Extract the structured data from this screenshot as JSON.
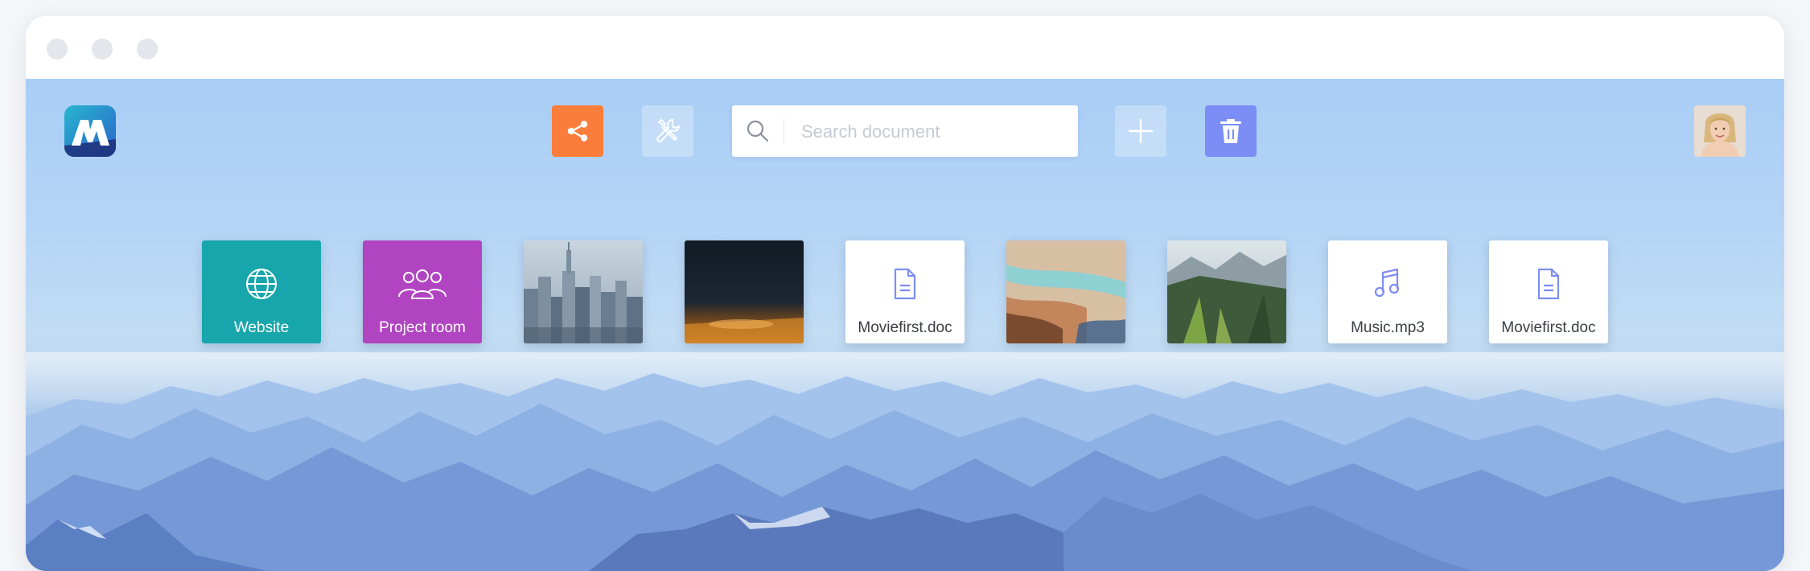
{
  "toolbar": {
    "search_placeholder": "Search document",
    "search_value": ""
  },
  "icons": {
    "logo": "app-logo-m",
    "share": "share-icon",
    "tools": "tools-icon",
    "search": "search-icon",
    "add": "plus-icon",
    "trash": "trash-icon",
    "avatar": "user-avatar"
  },
  "tiles": [
    {
      "label": "Website",
      "type": "link",
      "icon": "globe-icon"
    },
    {
      "label": "Project room",
      "type": "folder",
      "icon": "users-icon"
    },
    {
      "label": "",
      "type": "image",
      "subject": "city skyline"
    },
    {
      "label": "",
      "type": "image",
      "subject": "night sky over horizon"
    },
    {
      "label": "Moviefirst.doc",
      "type": "document",
      "icon": "document-icon"
    },
    {
      "label": "",
      "type": "image",
      "subject": "aerial river"
    },
    {
      "label": "",
      "type": "image",
      "subject": "forest valley"
    },
    {
      "label": "Music.mp3",
      "type": "audio",
      "icon": "music-icon"
    },
    {
      "label": "Moviefirst.doc",
      "type": "document",
      "icon": "document-icon"
    }
  ],
  "colors": {
    "share_button": "#fb7d3c",
    "trash_button": "#7c8df6",
    "website_tile": "#17a6ab",
    "project_room_tile": "#b145c1",
    "file_icon": "#7d8df2"
  }
}
